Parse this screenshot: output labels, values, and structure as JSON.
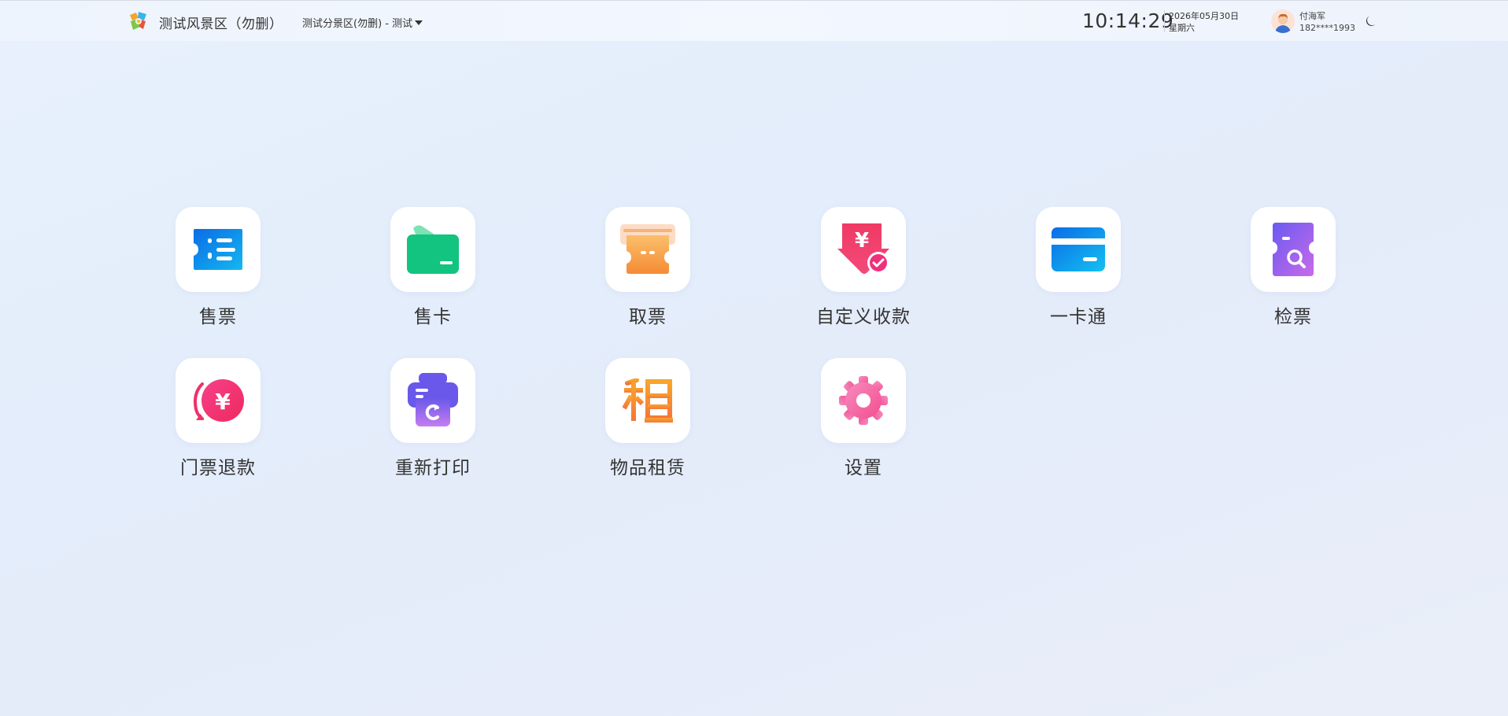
{
  "header": {
    "scenic_name": "测试风景区（勿删）",
    "subarea_selector": "测试分景区(勿删) - 测试",
    "time": "10:14:29",
    "date": "2026年05月30日",
    "weekday": "星期六",
    "user_name": "付海军",
    "user_phone": "182****1993",
    "icons": {
      "logo": "colorful-scenic-logo-icon",
      "dropdown": "caret-down-icon",
      "avatar": "user-avatar-icon",
      "theme": "moon-icon"
    }
  },
  "menu": {
    "items": [
      {
        "label": "售票",
        "icon": "ticket-sale-icon"
      },
      {
        "label": "售卡",
        "icon": "card-wallet-icon"
      },
      {
        "label": "取票",
        "icon": "ticket-collect-icon"
      },
      {
        "label": "自定义收款",
        "icon": "custom-payment-icon"
      },
      {
        "label": "一卡通",
        "icon": "credit-card-icon"
      },
      {
        "label": "检票",
        "icon": "ticket-check-icon"
      },
      {
        "label": "门票退款",
        "icon": "refund-icon"
      },
      {
        "label": "重新打印",
        "icon": "reprint-icon"
      },
      {
        "label": "物品租赁",
        "icon": "rental-icon"
      },
      {
        "label": "设置",
        "icon": "settings-gear-icon"
      }
    ]
  },
  "colors": {
    "sell_ticket": "#0a84e8",
    "sell_card": "#0fc47e",
    "collect_ticket": "#f58b34",
    "custom_payment": "#f23d6a",
    "card": "#1a8cf0",
    "check_ticket": "#7a5af0",
    "refund": "#f0307a",
    "reprint": "#7064e8",
    "rental": "#f59032",
    "settings": "#f56aa8"
  }
}
